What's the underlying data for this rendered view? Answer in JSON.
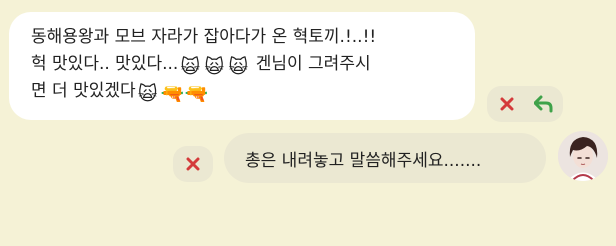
{
  "conversation": {
    "incoming": {
      "line1": "동해용왕과 모브 자라가 잡아다가 온 혁토끼.!..!!",
      "line2_text": "헉 맛있다.. 맛있다...",
      "line2_tail": " 겐님이 그려주시",
      "line3_text": "면 더 맛있겠다",
      "emojis": {
        "cat_face": "🙀",
        "squirt_gun": "🔫"
      },
      "actions": {
        "delete_icon": "close-icon",
        "reply_icon": "reply-arrow-icon"
      }
    },
    "outgoing": {
      "text": "총은 내려놓고 말씀해주세요.......",
      "actions": {
        "delete_icon": "close-icon"
      }
    }
  },
  "colors": {
    "background": "#f5f2d6",
    "incoming_bubble": "#ffffff",
    "outgoing_bubble": "#ebe8d2",
    "delete_red": "#d43b3b",
    "reply_green": "#3fa24a"
  }
}
